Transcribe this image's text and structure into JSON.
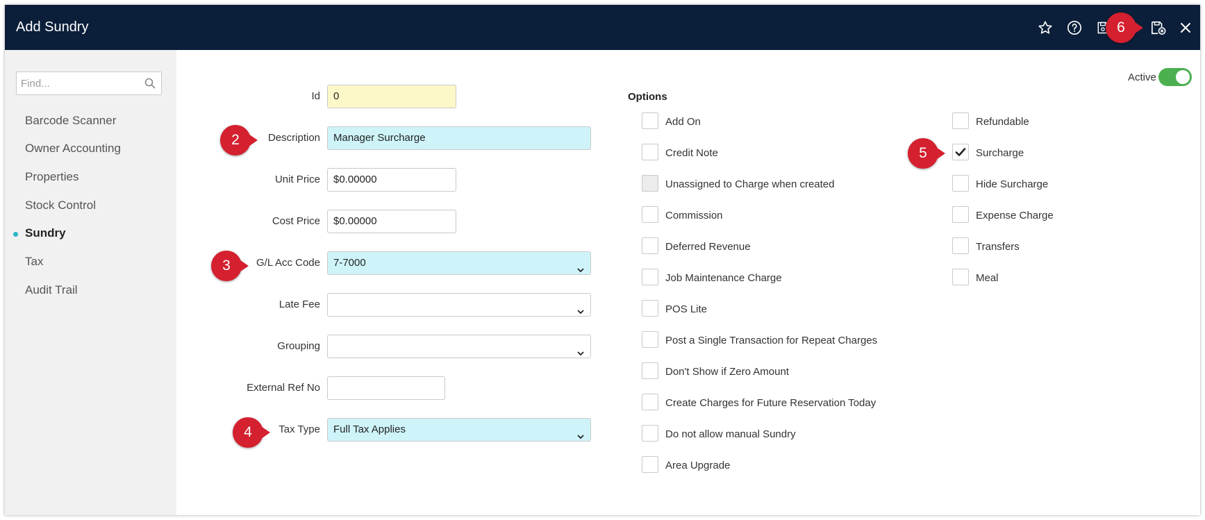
{
  "window": {
    "title": "Add Sundry"
  },
  "toolbar": {
    "icons": [
      "star-icon",
      "help-icon",
      "save-icon",
      "save-and-close-icon",
      "close-icon"
    ]
  },
  "sidebar": {
    "search_placeholder": "Find...",
    "items": [
      {
        "label": "Barcode Scanner",
        "active": false
      },
      {
        "label": "Owner Accounting",
        "active": false
      },
      {
        "label": "Properties",
        "active": false
      },
      {
        "label": "Stock Control",
        "active": false
      },
      {
        "label": "Sundry",
        "active": true
      },
      {
        "label": "Tax",
        "active": false
      },
      {
        "label": "Audit Trail",
        "active": false
      }
    ]
  },
  "form": {
    "id": {
      "label": "Id",
      "value": "0"
    },
    "description": {
      "label": "Description",
      "value": "Manager Surcharge"
    },
    "unit_price": {
      "label": "Unit Price",
      "value": "$0.00000"
    },
    "cost_price": {
      "label": "Cost Price",
      "value": "$0.00000"
    },
    "gl_acc_code": {
      "label": "G/L Acc Code",
      "value": "7-7000"
    },
    "late_fee": {
      "label": "Late Fee",
      "value": ""
    },
    "grouping": {
      "label": "Grouping",
      "value": ""
    },
    "external_ref": {
      "label": "External Ref No",
      "value": ""
    },
    "tax_type": {
      "label": "Tax Type",
      "value": "Full Tax Applies"
    }
  },
  "options": {
    "title": "Options",
    "left": [
      {
        "label": "Add On",
        "checked": false,
        "disabled": false
      },
      {
        "label": "Credit Note",
        "checked": false,
        "disabled": false
      },
      {
        "label": "Unassigned to Charge when created",
        "checked": false,
        "disabled": true
      },
      {
        "label": "Commission",
        "checked": false,
        "disabled": false
      },
      {
        "label": "Deferred Revenue",
        "checked": false,
        "disabled": false
      },
      {
        "label": "Job Maintenance Charge",
        "checked": false,
        "disabled": false
      },
      {
        "label": "POS Lite",
        "checked": false,
        "disabled": false
      },
      {
        "label": "Post a Single Transaction for Repeat Charges",
        "checked": false,
        "disabled": false
      },
      {
        "label": "Don't Show if Zero Amount",
        "checked": false,
        "disabled": false
      },
      {
        "label": "Create Charges for Future Reservation Today",
        "checked": false,
        "disabled": false
      },
      {
        "label": "Do not allow manual Sundry",
        "checked": false,
        "disabled": false
      },
      {
        "label": "Area Upgrade",
        "checked": false,
        "disabled": false
      }
    ],
    "right": [
      {
        "label": "Refundable",
        "checked": false
      },
      {
        "label": "Surcharge",
        "checked": true
      },
      {
        "label": "Hide Surcharge",
        "checked": false
      },
      {
        "label": "Expense Charge",
        "checked": false
      },
      {
        "label": "Transfers",
        "checked": false
      },
      {
        "label": "Meal",
        "checked": false
      }
    ]
  },
  "status": {
    "active_label": "Active",
    "active": true
  },
  "markers": [
    "2",
    "3",
    "4",
    "5",
    "6"
  ],
  "colors": {
    "titlebar": "#0b1f3a",
    "required_field": "#cef4f9",
    "readonly_field": "#fdf8c8",
    "toggle_on": "#4caf50",
    "marker": "#d4202f",
    "active_dot": "#2bb6c6"
  }
}
